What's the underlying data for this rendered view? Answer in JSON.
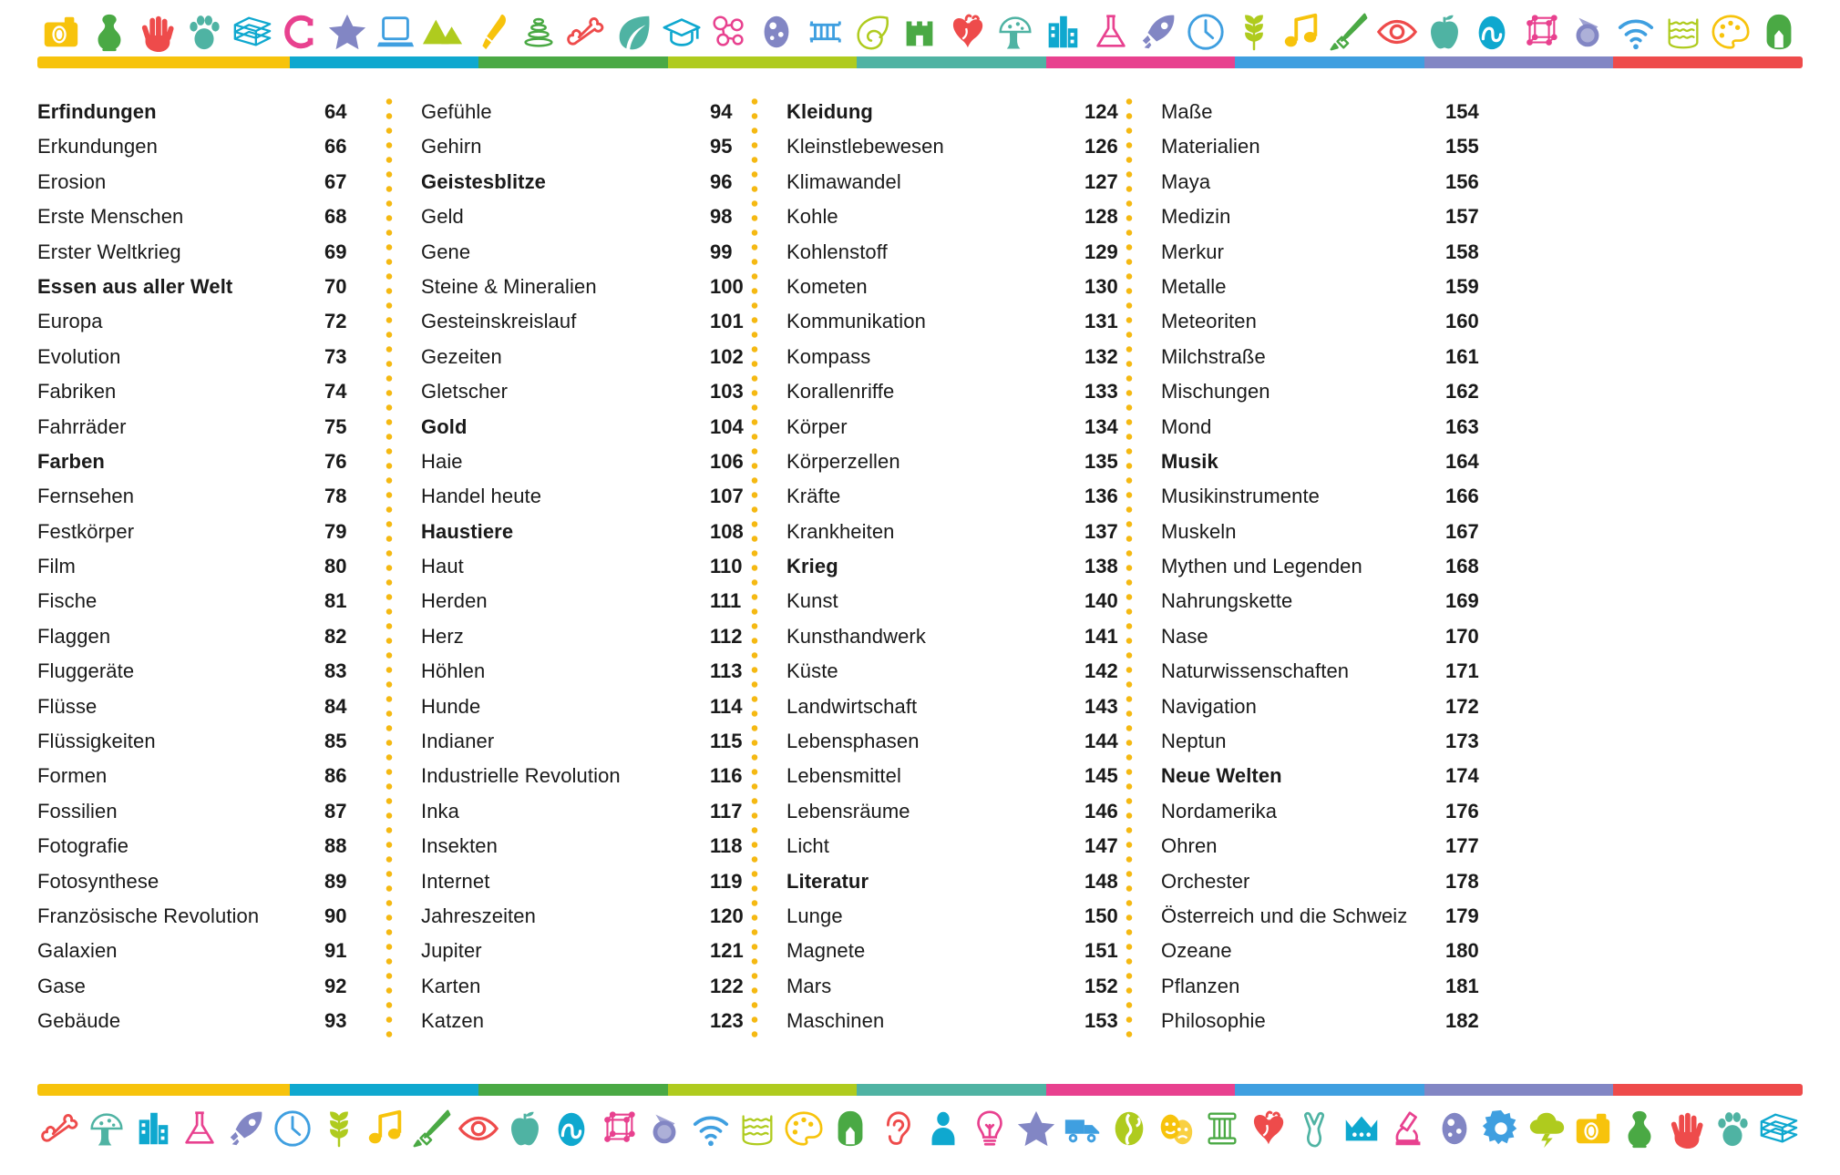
{
  "page": {
    "type": "index",
    "language": "de"
  },
  "colors": {
    "yellow": "#F7C30C",
    "cyan": "#0FA8CF",
    "green": "#4AA944",
    "lime": "#AFCB1E",
    "teal": "#4FB3A3",
    "pink": "#E8418F",
    "blue": "#3F9FE0",
    "purple": "#8286C4",
    "red": "#EE4B4B",
    "dot_orange": "#F5B913",
    "text": "#1a1a1a"
  },
  "top_band": {
    "rule_segments": [
      {
        "color": "#F7C30C",
        "flex": 4
      },
      {
        "color": "#0FA8CF",
        "flex": 3
      },
      {
        "color": "#4AA944",
        "flex": 3
      },
      {
        "color": "#AFCB1E",
        "flex": 3
      },
      {
        "color": "#4FB3A3",
        "flex": 3
      },
      {
        "color": "#E8418F",
        "flex": 3
      },
      {
        "color": "#3F9FE0",
        "flex": 3
      },
      {
        "color": "#8286C4",
        "flex": 3
      },
      {
        "color": "#EE4B4B",
        "flex": 3
      }
    ],
    "icons": [
      {
        "name": "camera-icon",
        "color": "#F7C30C"
      },
      {
        "name": "vase-icon",
        "color": "#4AA944"
      },
      {
        "name": "hand-icon",
        "color": "#EE4B4B"
      },
      {
        "name": "paw-print-icon",
        "color": "#4FB3A3"
      },
      {
        "name": "books-stack-icon",
        "color": "#0FA8CF"
      },
      {
        "name": "magnet-icon",
        "color": "#E8418F"
      },
      {
        "name": "star-icon",
        "color": "#8286C4"
      },
      {
        "name": "laptop-icon",
        "color": "#3F9FE0"
      },
      {
        "name": "mountains-icon",
        "color": "#AFCB1E"
      },
      {
        "name": "paintbrush-icon",
        "color": "#F7C30C"
      },
      {
        "name": "stacking-rings-icon",
        "color": "#4AA944"
      },
      {
        "name": "bone-icon",
        "color": "#EE4B4B"
      },
      {
        "name": "leaf-icon",
        "color": "#4FB3A3"
      },
      {
        "name": "graduation-cap-icon",
        "color": "#0FA8CF"
      },
      {
        "name": "molecule-icon",
        "color": "#E8418F"
      },
      {
        "name": "cell-icon",
        "color": "#8286C4"
      },
      {
        "name": "dna-comb-icon",
        "color": "#3F9FE0"
      },
      {
        "name": "spiral-shell-icon",
        "color": "#AFCB1E"
      },
      {
        "name": "castle-icon",
        "color": "#4AA944"
      },
      {
        "name": "heart-anatomy-icon",
        "color": "#EE4B4B"
      },
      {
        "name": "mushroom-icon",
        "color": "#4FB3A3"
      },
      {
        "name": "buildings-icon",
        "color": "#0FA8CF"
      },
      {
        "name": "flask-icon",
        "color": "#E8418F"
      },
      {
        "name": "rocket-icon",
        "color": "#8286C4"
      },
      {
        "name": "clock-icon",
        "color": "#3F9FE0"
      },
      {
        "name": "wheat-icon",
        "color": "#AFCB1E"
      },
      {
        "name": "music-note-icon",
        "color": "#F7C30C"
      },
      {
        "name": "sword-icon",
        "color": "#4AA944"
      },
      {
        "name": "eye-icon",
        "color": "#EE4B4B"
      },
      {
        "name": "apple-icon",
        "color": "#4FB3A3"
      },
      {
        "name": "brain-icon",
        "color": "#0FA8CF"
      },
      {
        "name": "crystal-lattice-icon",
        "color": "#E8418F"
      },
      {
        "name": "comet-icon",
        "color": "#8286C4"
      },
      {
        "name": "wifi-icon",
        "color": "#3F9FE0"
      },
      {
        "name": "water-icon",
        "color": "#AFCB1E"
      },
      {
        "name": "palette-icon",
        "color": "#F7C30C"
      },
      {
        "name": "helmet-icon",
        "color": "#4AA944"
      }
    ]
  },
  "bottom_band": {
    "rule_segments": [
      {
        "color": "#F7C30C",
        "flex": 4
      },
      {
        "color": "#0FA8CF",
        "flex": 3
      },
      {
        "color": "#4AA944",
        "flex": 3
      },
      {
        "color": "#AFCB1E",
        "flex": 3
      },
      {
        "color": "#4FB3A3",
        "flex": 3
      },
      {
        "color": "#E8418F",
        "flex": 3
      },
      {
        "color": "#3F9FE0",
        "flex": 3
      },
      {
        "color": "#8286C4",
        "flex": 3
      },
      {
        "color": "#EE4B4B",
        "flex": 3
      }
    ],
    "icons": [
      {
        "name": "bone-icon",
        "color": "#EE4B4B"
      },
      {
        "name": "mushroom-icon",
        "color": "#4FB3A3"
      },
      {
        "name": "buildings-icon",
        "color": "#0FA8CF"
      },
      {
        "name": "flask-icon",
        "color": "#E8418F"
      },
      {
        "name": "rocket-icon",
        "color": "#8286C4"
      },
      {
        "name": "clock-icon",
        "color": "#3F9FE0"
      },
      {
        "name": "wheat-icon",
        "color": "#AFCB1E"
      },
      {
        "name": "music-note-icon",
        "color": "#F7C30C"
      },
      {
        "name": "sword-icon",
        "color": "#4AA944"
      },
      {
        "name": "eye-icon",
        "color": "#EE4B4B"
      },
      {
        "name": "apple-icon",
        "color": "#4FB3A3"
      },
      {
        "name": "brain-icon",
        "color": "#0FA8CF"
      },
      {
        "name": "crystal-lattice-icon",
        "color": "#E8418F"
      },
      {
        "name": "comet-icon",
        "color": "#8286C4"
      },
      {
        "name": "wifi-icon",
        "color": "#3F9FE0"
      },
      {
        "name": "water-icon",
        "color": "#AFCB1E"
      },
      {
        "name": "palette-icon",
        "color": "#F7C30C"
      },
      {
        "name": "helmet-icon",
        "color": "#4AA944"
      },
      {
        "name": "ear-icon",
        "color": "#EE4B4B"
      },
      {
        "name": "person-icon",
        "color": "#0FA8CF"
      },
      {
        "name": "lightbulb-icon",
        "color": "#E8418F"
      },
      {
        "name": "star-icon",
        "color": "#8286C4"
      },
      {
        "name": "truck-icon",
        "color": "#3F9FE0"
      },
      {
        "name": "globe-icon",
        "color": "#AFCB1E"
      },
      {
        "name": "theatre-masks-icon",
        "color": "#F7C30C"
      },
      {
        "name": "column-icon",
        "color": "#4AA944"
      },
      {
        "name": "heart-anatomy-icon",
        "color": "#EE4B4B"
      },
      {
        "name": "dinosaur-footprint-icon",
        "color": "#4FB3A3"
      },
      {
        "name": "crown-icon",
        "color": "#0FA8CF"
      },
      {
        "name": "microscope-icon",
        "color": "#E8418F"
      },
      {
        "name": "cell-icon",
        "color": "#8286C4"
      },
      {
        "name": "gear-icon",
        "color": "#3F9FE0"
      },
      {
        "name": "storm-cloud-icon",
        "color": "#AFCB1E"
      },
      {
        "name": "camera-icon",
        "color": "#F7C30C"
      },
      {
        "name": "vase-icon",
        "color": "#4AA944"
      },
      {
        "name": "hand-icon",
        "color": "#EE4B4B"
      },
      {
        "name": "paw-print-icon",
        "color": "#4FB3A3"
      },
      {
        "name": "books-stack-icon",
        "color": "#0FA8CF"
      }
    ]
  },
  "index_columns": [
    {
      "id": "column-1",
      "entries": [
        {
          "title": "Erfindungen",
          "page": "64",
          "bold": true
        },
        {
          "title": "Erkundungen",
          "page": "66",
          "bold": false
        },
        {
          "title": "Erosion",
          "page": "67",
          "bold": false
        },
        {
          "title": "Erste Menschen",
          "page": "68",
          "bold": false
        },
        {
          "title": "Erster Weltkrieg",
          "page": "69",
          "bold": false
        },
        {
          "title": "Essen aus aller Welt",
          "page": "70",
          "bold": true
        },
        {
          "title": "Europa",
          "page": "72",
          "bold": false
        },
        {
          "title": "Evolution",
          "page": "73",
          "bold": false
        },
        {
          "title": "Fabriken",
          "page": "74",
          "bold": false
        },
        {
          "title": "Fahrräder",
          "page": "75",
          "bold": false
        },
        {
          "title": "Farben",
          "page": "76",
          "bold": true
        },
        {
          "title": "Fernsehen",
          "page": "78",
          "bold": false
        },
        {
          "title": "Festkörper",
          "page": "79",
          "bold": false
        },
        {
          "title": "Film",
          "page": "80",
          "bold": false
        },
        {
          "title": "Fische",
          "page": "81",
          "bold": false
        },
        {
          "title": "Flaggen",
          "page": "82",
          "bold": false
        },
        {
          "title": "Fluggeräte",
          "page": "83",
          "bold": false
        },
        {
          "title": "Flüsse",
          "page": "84",
          "bold": false
        },
        {
          "title": "Flüssigkeiten",
          "page": "85",
          "bold": false
        },
        {
          "title": "Formen",
          "page": "86",
          "bold": false
        },
        {
          "title": "Fossilien",
          "page": "87",
          "bold": false
        },
        {
          "title": "Fotografie",
          "page": "88",
          "bold": false
        },
        {
          "title": "Fotosynthese",
          "page": "89",
          "bold": false
        },
        {
          "title": "Französische Revolution",
          "page": "90",
          "bold": false
        },
        {
          "title": "Galaxien",
          "page": "91",
          "bold": false
        },
        {
          "title": "Gase",
          "page": "92",
          "bold": false
        },
        {
          "title": "Gebäude",
          "page": "93",
          "bold": false
        }
      ]
    },
    {
      "id": "column-2",
      "entries": [
        {
          "title": "Gefühle",
          "page": "94",
          "bold": false
        },
        {
          "title": "Gehirn",
          "page": "95",
          "bold": false
        },
        {
          "title": "Geistesblitze",
          "page": "96",
          "bold": true
        },
        {
          "title": "Geld",
          "page": "98",
          "bold": false
        },
        {
          "title": "Gene",
          "page": "99",
          "bold": false
        },
        {
          "title": "Steine & Mineralien",
          "page": "100",
          "bold": false
        },
        {
          "title": "Gesteinskreislauf",
          "page": "101",
          "bold": false
        },
        {
          "title": "Gezeiten",
          "page": "102",
          "bold": false
        },
        {
          "title": "Gletscher",
          "page": "103",
          "bold": false
        },
        {
          "title": "Gold",
          "page": "104",
          "bold": true
        },
        {
          "title": "Haie",
          "page": "106",
          "bold": false
        },
        {
          "title": "Handel heute",
          "page": "107",
          "bold": false
        },
        {
          "title": "Haustiere",
          "page": "108",
          "bold": true
        },
        {
          "title": "Haut",
          "page": "110",
          "bold": false
        },
        {
          "title": "Herden",
          "page": "111",
          "bold": false
        },
        {
          "title": "Herz",
          "page": "112",
          "bold": false
        },
        {
          "title": "Höhlen",
          "page": "113",
          "bold": false
        },
        {
          "title": "Hunde",
          "page": "114",
          "bold": false
        },
        {
          "title": "Indianer",
          "page": "115",
          "bold": false
        },
        {
          "title": "Industrielle Revolution",
          "page": "116",
          "bold": false
        },
        {
          "title": "Inka",
          "page": "117",
          "bold": false
        },
        {
          "title": "Insekten",
          "page": "118",
          "bold": false
        },
        {
          "title": "Internet",
          "page": "119",
          "bold": false
        },
        {
          "title": "Jahreszeiten",
          "page": "120",
          "bold": false
        },
        {
          "title": "Jupiter",
          "page": "121",
          "bold": false
        },
        {
          "title": "Karten",
          "page": "122",
          "bold": false
        },
        {
          "title": "Katzen",
          "page": "123",
          "bold": false
        }
      ]
    },
    {
      "id": "column-3",
      "entries": [
        {
          "title": "Kleidung",
          "page": "124",
          "bold": true
        },
        {
          "title": "Kleinstlebewesen",
          "page": "126",
          "bold": false
        },
        {
          "title": "Klimawandel",
          "page": "127",
          "bold": false
        },
        {
          "title": "Kohle",
          "page": "128",
          "bold": false
        },
        {
          "title": "Kohlenstoff",
          "page": "129",
          "bold": false
        },
        {
          "title": "Kometen",
          "page": "130",
          "bold": false
        },
        {
          "title": "Kommunikation",
          "page": "131",
          "bold": false
        },
        {
          "title": "Kompass",
          "page": "132",
          "bold": false
        },
        {
          "title": "Korallenriffe",
          "page": "133",
          "bold": false
        },
        {
          "title": "Körper",
          "page": "134",
          "bold": false
        },
        {
          "title": "Körperzellen",
          "page": "135",
          "bold": false
        },
        {
          "title": "Kräfte",
          "page": "136",
          "bold": false
        },
        {
          "title": "Krankheiten",
          "page": "137",
          "bold": false
        },
        {
          "title": "Krieg",
          "page": "138",
          "bold": true
        },
        {
          "title": "Kunst",
          "page": "140",
          "bold": false
        },
        {
          "title": "Kunsthandwerk",
          "page": "141",
          "bold": false
        },
        {
          "title": "Küste",
          "page": "142",
          "bold": false
        },
        {
          "title": "Landwirtschaft",
          "page": "143",
          "bold": false
        },
        {
          "title": "Lebensphasen",
          "page": "144",
          "bold": false
        },
        {
          "title": "Lebensmittel",
          "page": "145",
          "bold": false
        },
        {
          "title": "Lebensräume",
          "page": "146",
          "bold": false
        },
        {
          "title": "Licht",
          "page": "147",
          "bold": false
        },
        {
          "title": "Literatur",
          "page": "148",
          "bold": true
        },
        {
          "title": "Lunge",
          "page": "150",
          "bold": false
        },
        {
          "title": "Magnete",
          "page": "151",
          "bold": false
        },
        {
          "title": "Mars",
          "page": "152",
          "bold": false
        },
        {
          "title": "Maschinen",
          "page": "153",
          "bold": false
        }
      ]
    },
    {
      "id": "column-4",
      "entries": [
        {
          "title": "Maße",
          "page": "154",
          "bold": false
        },
        {
          "title": "Materialien",
          "page": "155",
          "bold": false
        },
        {
          "title": "Maya",
          "page": "156",
          "bold": false
        },
        {
          "title": "Medizin",
          "page": "157",
          "bold": false
        },
        {
          "title": "Merkur",
          "page": "158",
          "bold": false
        },
        {
          "title": "Metalle",
          "page": "159",
          "bold": false
        },
        {
          "title": "Meteoriten",
          "page": "160",
          "bold": false
        },
        {
          "title": "Milchstraße",
          "page": "161",
          "bold": false
        },
        {
          "title": "Mischungen",
          "page": "162",
          "bold": false
        },
        {
          "title": "Mond",
          "page": "163",
          "bold": false
        },
        {
          "title": "Musik",
          "page": "164",
          "bold": true
        },
        {
          "title": "Musikinstrumente",
          "page": "166",
          "bold": false
        },
        {
          "title": "Muskeln",
          "page": "167",
          "bold": false
        },
        {
          "title": "Mythen und Legenden",
          "page": "168",
          "bold": false
        },
        {
          "title": "Nahrungskette",
          "page": "169",
          "bold": false
        },
        {
          "title": "Nase",
          "page": "170",
          "bold": false
        },
        {
          "title": "Naturwissenschaften",
          "page": "171",
          "bold": false
        },
        {
          "title": "Navigation",
          "page": "172",
          "bold": false
        },
        {
          "title": "Neptun",
          "page": "173",
          "bold": false
        },
        {
          "title": "Neue Welten",
          "page": "174",
          "bold": true
        },
        {
          "title": "Nordamerika",
          "page": "176",
          "bold": false
        },
        {
          "title": "Ohren",
          "page": "177",
          "bold": false
        },
        {
          "title": "Orchester",
          "page": "178",
          "bold": false
        },
        {
          "title": "Österreich und die Schweiz",
          "page": "179",
          "bold": false
        },
        {
          "title": "Ozeane",
          "page": "180",
          "bold": false
        },
        {
          "title": "Pflanzen",
          "page": "181",
          "bold": false
        },
        {
          "title": "Philosophie",
          "page": "182",
          "bold": false
        }
      ]
    }
  ]
}
